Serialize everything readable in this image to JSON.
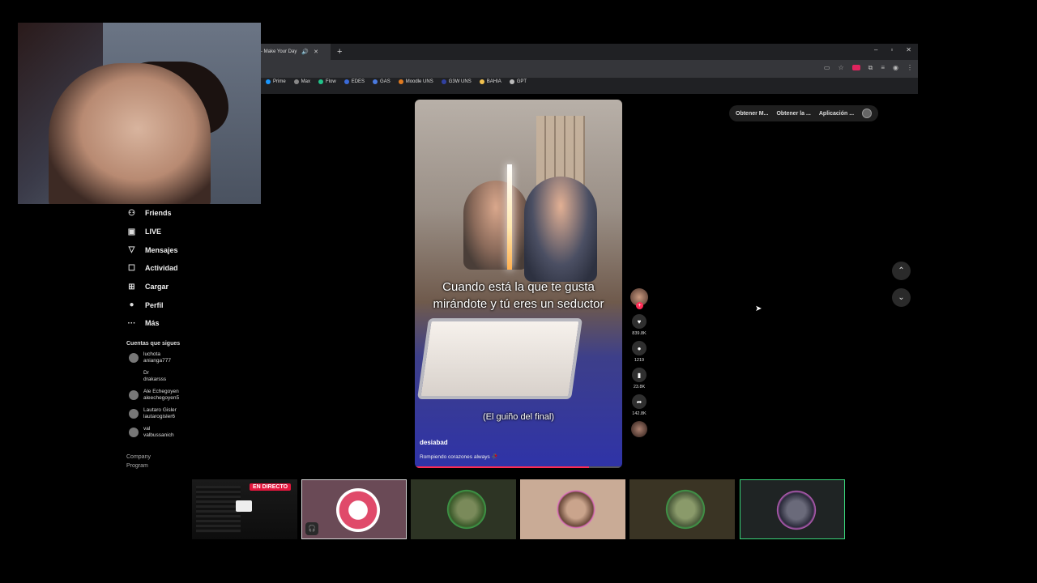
{
  "browser": {
    "tab_title": "- Make Your Day",
    "new_tab": "+",
    "window_controls": [
      "–",
      "▫",
      "✕"
    ],
    "bookmarks": [
      {
        "label": "Prime",
        "color": "#1a98ff"
      },
      {
        "label": "Max",
        "color": "#888888"
      },
      {
        "label": "Flow",
        "color": "#22c28a"
      },
      {
        "label": "EDES",
        "color": "#3a6ad8"
      },
      {
        "label": "GAS",
        "color": "#4a7adf"
      },
      {
        "label": "Moodle UNS",
        "color": "#e07a20"
      },
      {
        "label": "G3W UNS",
        "color": "#3040a0"
      },
      {
        "label": "BAHIA",
        "color": "#f2c14e"
      },
      {
        "label": "GPT",
        "color": "#bbbbbb"
      }
    ]
  },
  "sidebar": {
    "items": [
      {
        "label": "Friends",
        "icon": "friends-icon",
        "glyph": "⚇"
      },
      {
        "label": "LIVE",
        "icon": "live-icon",
        "glyph": "▣"
      },
      {
        "label": "Mensajes",
        "icon": "messages-icon",
        "glyph": "▽"
      },
      {
        "label": "Actividad",
        "icon": "activity-icon",
        "glyph": "☐"
      },
      {
        "label": "Cargar",
        "icon": "upload-icon",
        "glyph": "⊞"
      },
      {
        "label": "Perfil",
        "icon": "profile-icon",
        "glyph": "●"
      },
      {
        "label": "Más",
        "icon": "more-icon",
        "glyph": "···"
      }
    ],
    "following_title": "Cuentas que sigues",
    "accounts": [
      {
        "name": "luchota",
        "handle": "anianga777"
      },
      {
        "name": "Dr",
        "handle": "drakarsss"
      },
      {
        "name": "Ale Echegoyen",
        "handle": "aleechegoyen5"
      },
      {
        "name": "Lautaro Gisler",
        "handle": "lautarogisler6"
      },
      {
        "name": "val",
        "handle": "valbussanich"
      }
    ],
    "footer": [
      "Company",
      "Program"
    ]
  },
  "video": {
    "caption": "Cuando está la que te gusta mirándote y tú eres un seductor",
    "subcaption": "(El guiño del final)",
    "username": "desiabad",
    "description": "Rompiendo corazones always 🥀",
    "progress": 0.84
  },
  "actions": {
    "likes": "839.8K",
    "comments": "1219",
    "saves": "23.8K",
    "shares": "142.8K"
  },
  "pills": [
    "Obtener M...",
    "Obtener la ...",
    "Aplicación ..."
  ],
  "stream": {
    "live_badge": "EN DIRECTO"
  }
}
